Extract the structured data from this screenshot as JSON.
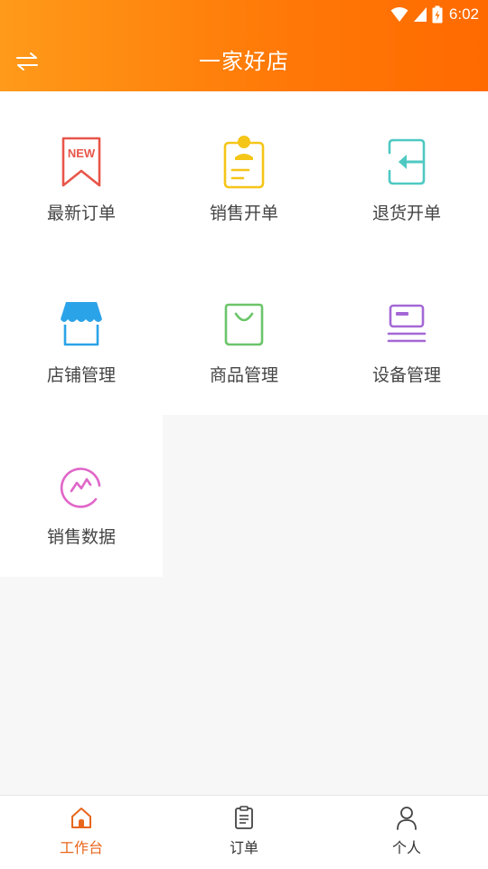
{
  "status_bar": {
    "time": "6:02",
    "icons": [
      "wifi-icon",
      "signal-icon",
      "battery-charging-icon"
    ]
  },
  "header": {
    "title": "一家好店",
    "switch_icon": "swap-arrows-icon"
  },
  "colors": {
    "header_gradient_start": "#ff9a1a",
    "header_gradient_end": "#ff6a00",
    "active_tab": "#e8661c"
  },
  "grid": {
    "items": [
      {
        "label": "最新订单",
        "icon": "new-badge-icon",
        "color": "#e8564a"
      },
      {
        "label": "销售开单",
        "icon": "clipboard-person-icon",
        "color": "#f5c518"
      },
      {
        "label": "退货开单",
        "icon": "return-arrow-icon",
        "color": "#4ec9c2"
      },
      {
        "label": "店铺管理",
        "icon": "storefront-icon",
        "color": "#2ba3e8"
      },
      {
        "label": "商品管理",
        "icon": "shopping-bag-icon",
        "color": "#6cc56a"
      },
      {
        "label": "设备管理",
        "icon": "card-device-icon",
        "color": "#a468d6"
      },
      {
        "label": "销售数据",
        "icon": "trend-circle-icon",
        "color": "#e066c8"
      }
    ]
  },
  "tab_bar": {
    "tabs": [
      {
        "label": "工作台",
        "icon": "home-icon",
        "active": true
      },
      {
        "label": "订单",
        "icon": "order-clipboard-icon",
        "active": false
      },
      {
        "label": "个人",
        "icon": "person-icon",
        "active": false
      }
    ]
  }
}
